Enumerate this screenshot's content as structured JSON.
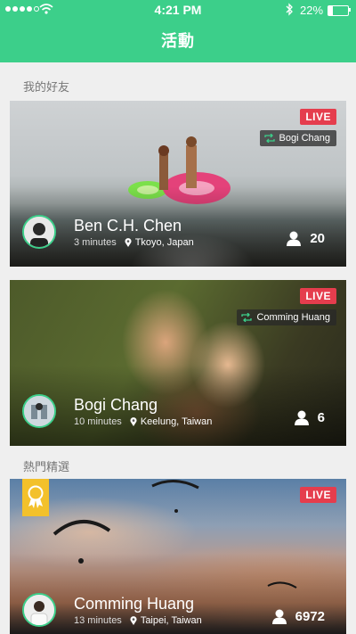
{
  "status_bar": {
    "time": "4:21 PM",
    "battery": "22%",
    "battery_level": 0.22
  },
  "header": {
    "title": "活動"
  },
  "sections": {
    "friends": "我的好友",
    "featured": "熱門精選"
  },
  "cards": [
    {
      "badge": "LIVE",
      "shared_by": "Bogi Chang",
      "name": "Ben C.H. Chen",
      "time": "3 minutes",
      "location": "Tkoyo, Japan",
      "viewers": "20"
    },
    {
      "badge": "LIVE",
      "shared_by": "Comming Huang",
      "name": "Bogi Chang",
      "time": "10 minutes",
      "location": "Keelung, Taiwan",
      "viewers": "6"
    },
    {
      "badge": "LIVE",
      "name": "Comming Huang",
      "time": "13 minutes",
      "location": "Taipei, Taiwan",
      "viewers": "6972"
    }
  ],
  "icons": {
    "repost": "repost-icon",
    "location": "location-pin-icon",
    "viewers": "person-icon",
    "medal": "award-medal-icon"
  },
  "colors": {
    "accent": "#3ccf8a",
    "live": "#e53d4d",
    "medal": "#f3c12b"
  }
}
